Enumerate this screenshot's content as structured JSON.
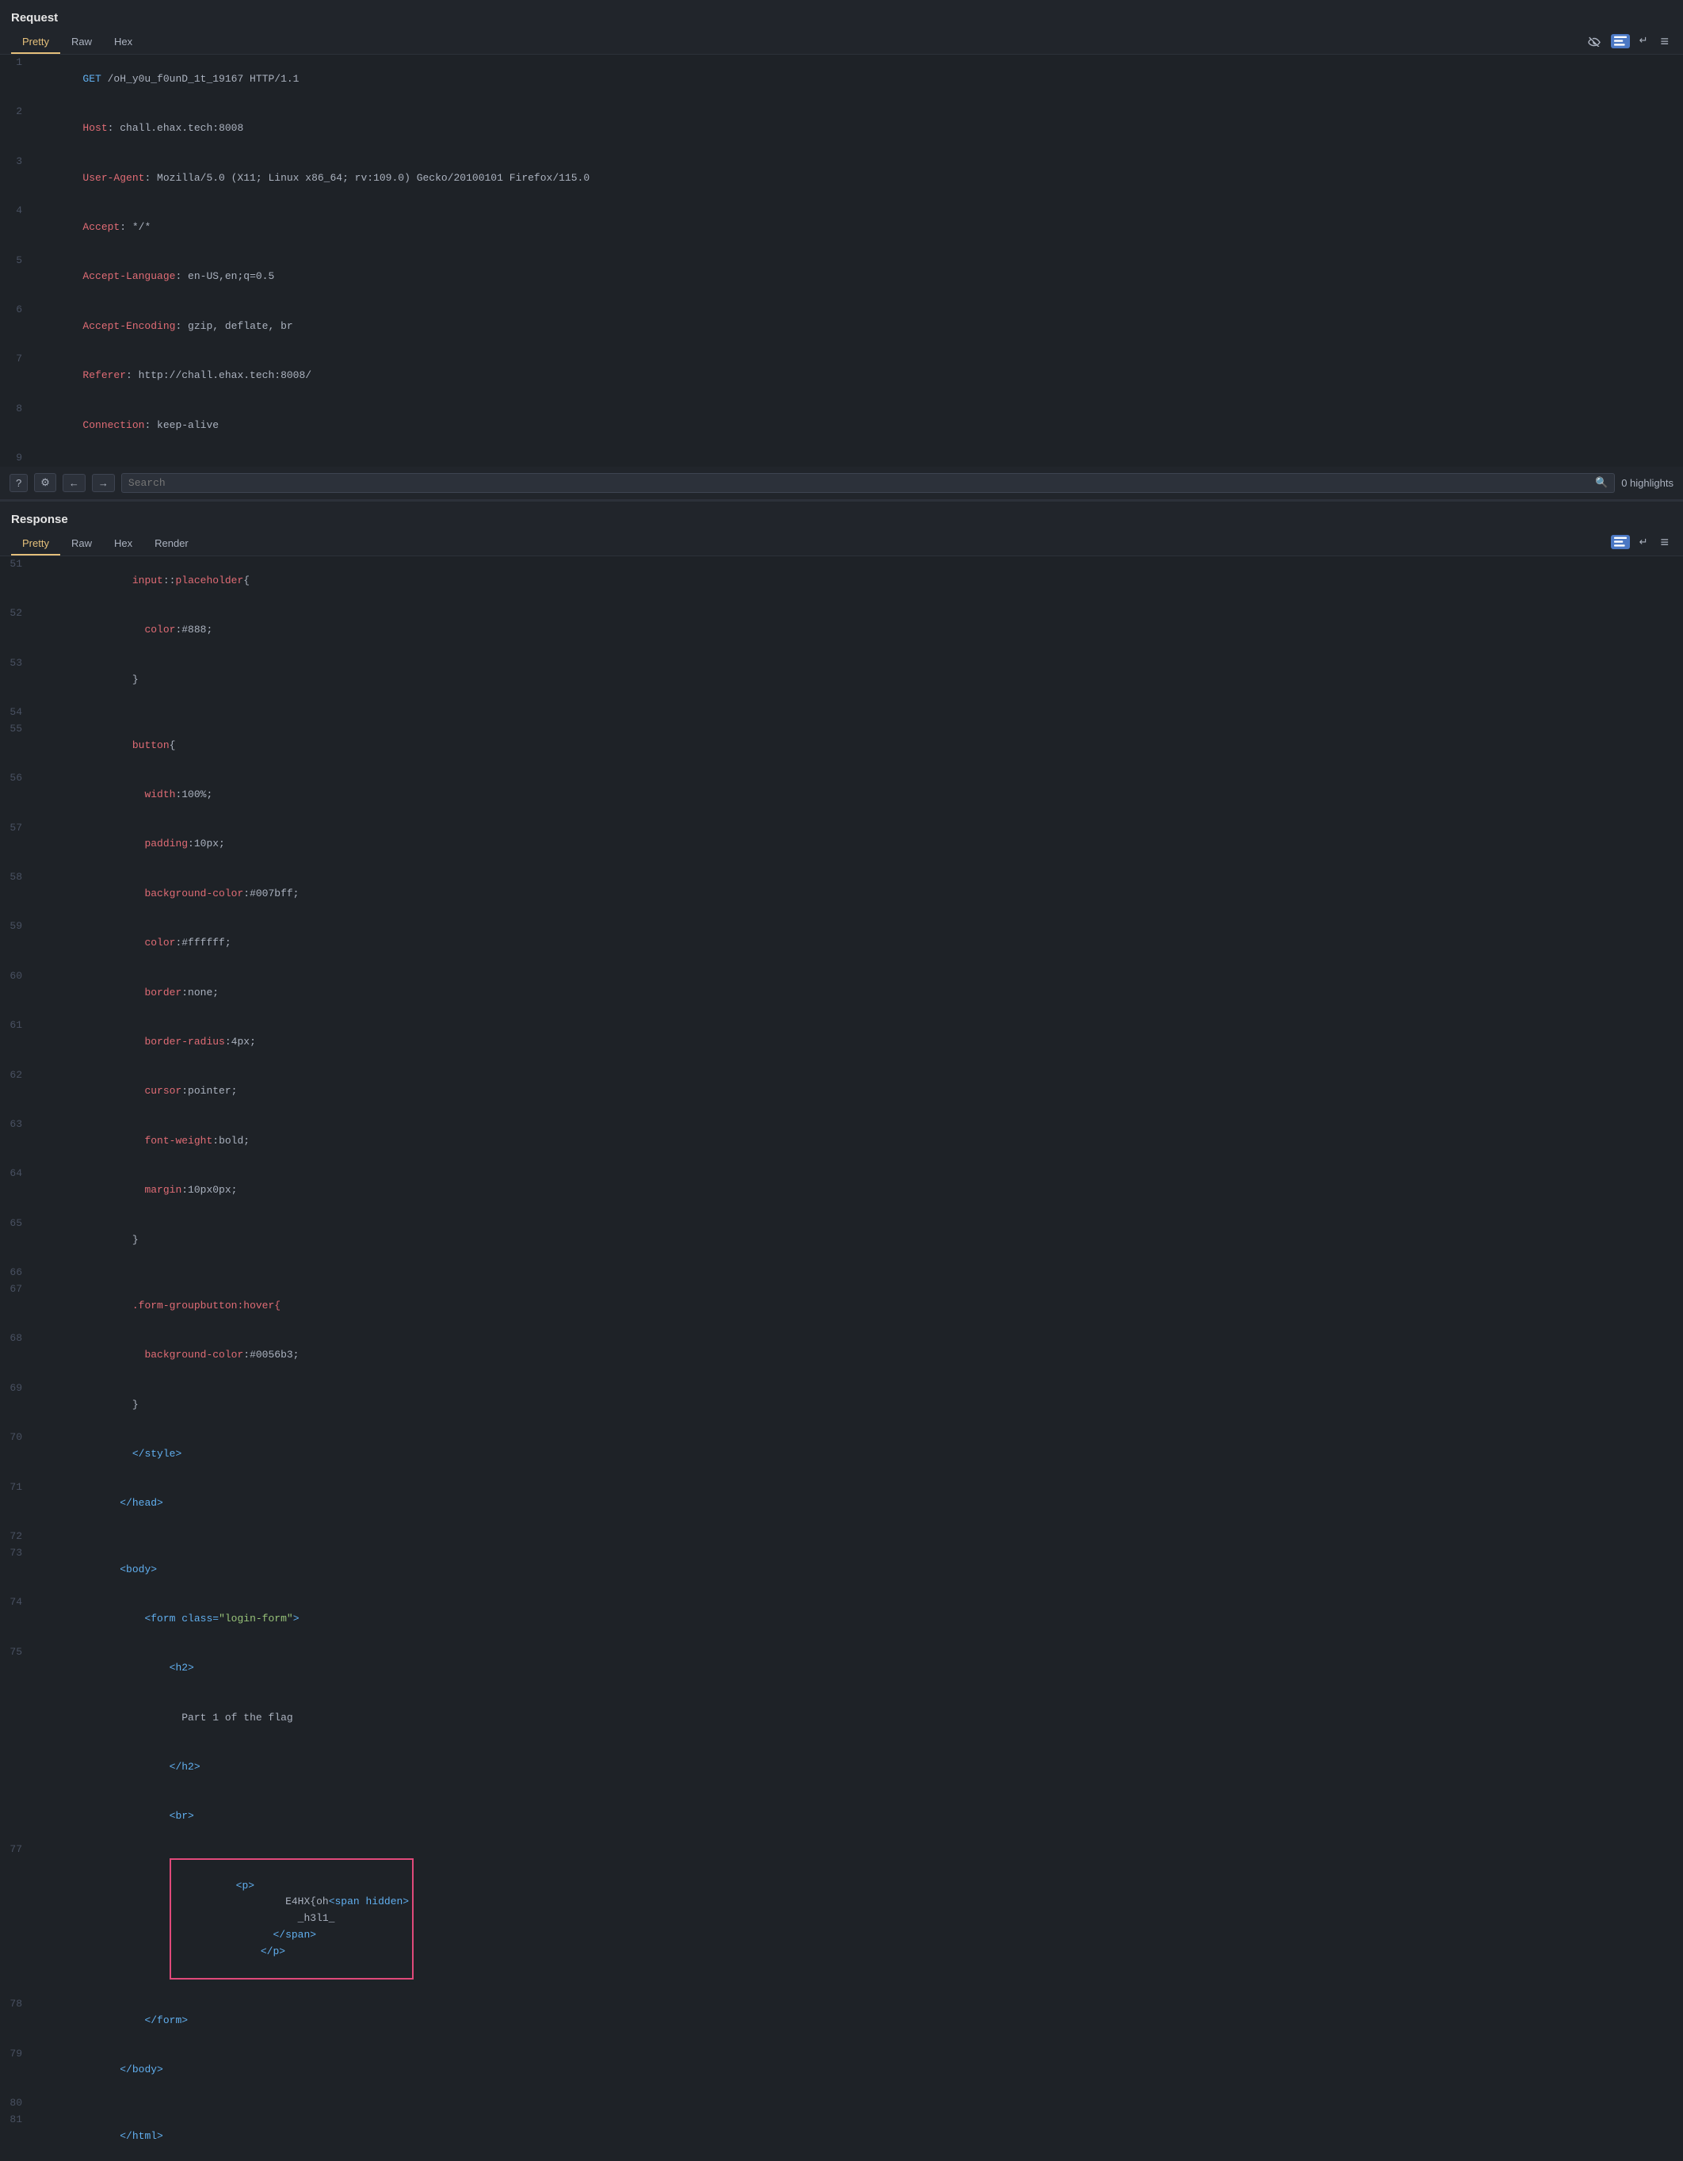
{
  "request": {
    "title": "Request",
    "tabs": [
      {
        "label": "Pretty",
        "active": true
      },
      {
        "label": "Raw",
        "active": false
      },
      {
        "label": "Hex",
        "active": false
      }
    ],
    "lines": [
      {
        "num": "1",
        "content": "GET /oH_y0u_f0unD_1t_19167 HTTP/1.1"
      },
      {
        "num": "2",
        "content": "Host: chall.ehax.tech:8008"
      },
      {
        "num": "3",
        "content": "User-Agent: Mozilla/5.0 (X11; Linux x86_64; rv:109.0) Gecko/20100101 Firefox/115.0"
      },
      {
        "num": "4",
        "content": "Accept: */*"
      },
      {
        "num": "5",
        "content": "Accept-Language: en-US,en;q=0.5"
      },
      {
        "num": "6",
        "content": "Accept-Encoding: gzip, deflate, br"
      },
      {
        "num": "7",
        "content": "Referer: http://chall.ehax.tech:8008/"
      },
      {
        "num": "8",
        "content": "Connection: keep-alive"
      },
      {
        "num": "9",
        "content": ""
      }
    ],
    "search": {
      "placeholder": "Search",
      "value": ""
    },
    "highlights": "0 highlights"
  },
  "response": {
    "title": "Response",
    "tabs": [
      {
        "label": "Pretty",
        "active": true
      },
      {
        "label": "Raw",
        "active": false
      },
      {
        "label": "Hex",
        "active": false
      },
      {
        "label": "Render",
        "active": false
      }
    ],
    "lines": [
      {
        "num": "51",
        "indent": "        ",
        "parts": [
          {
            "text": "input",
            "class": "c-red"
          },
          {
            "text": "::placeholder{",
            "class": "c-white"
          }
        ]
      },
      {
        "num": "52",
        "indent": "          ",
        "parts": [
          {
            "text": "color",
            "class": "c-red"
          },
          {
            "text": ":#888;",
            "class": "c-white"
          }
        ]
      },
      {
        "num": "53",
        "indent": "        ",
        "parts": [
          {
            "text": "}",
            "class": "c-white"
          }
        ]
      },
      {
        "num": "54",
        "indent": "",
        "parts": [
          {
            "text": "",
            "class": "c-white"
          }
        ]
      },
      {
        "num": "55",
        "indent": "        ",
        "parts": [
          {
            "text": "button",
            "class": "c-red"
          },
          {
            "text": "{",
            "class": "c-white"
          }
        ]
      },
      {
        "num": "56",
        "indent": "          ",
        "parts": [
          {
            "text": "width",
            "class": "c-red"
          },
          {
            "text": ":100%;",
            "class": "c-white"
          }
        ]
      },
      {
        "num": "57",
        "indent": "          ",
        "parts": [
          {
            "text": "padding",
            "class": "c-red"
          },
          {
            "text": ":10px;",
            "class": "c-white"
          }
        ]
      },
      {
        "num": "58",
        "indent": "          ",
        "parts": [
          {
            "text": "background-color",
            "class": "c-red"
          },
          {
            "text": ":#007bff;",
            "class": "c-white"
          }
        ]
      },
      {
        "num": "59",
        "indent": "          ",
        "parts": [
          {
            "text": "color",
            "class": "c-red"
          },
          {
            "text": ":#ffffff;",
            "class": "c-white"
          }
        ]
      },
      {
        "num": "60",
        "indent": "          ",
        "parts": [
          {
            "text": "border",
            "class": "c-red"
          },
          {
            "text": ":none;",
            "class": "c-white"
          }
        ]
      },
      {
        "num": "61",
        "indent": "          ",
        "parts": [
          {
            "text": "border-radius",
            "class": "c-red"
          },
          {
            "text": ":4px;",
            "class": "c-white"
          }
        ]
      },
      {
        "num": "62",
        "indent": "          ",
        "parts": [
          {
            "text": "cursor",
            "class": "c-red"
          },
          {
            "text": ":pointer;",
            "class": "c-white"
          }
        ]
      },
      {
        "num": "63",
        "indent": "          ",
        "parts": [
          {
            "text": "font-weight",
            "class": "c-red"
          },
          {
            "text": ":bold;",
            "class": "c-white"
          }
        ]
      },
      {
        "num": "64",
        "indent": "          ",
        "parts": [
          {
            "text": "margin",
            "class": "c-red"
          },
          {
            "text": ":10px0px;",
            "class": "c-white"
          }
        ]
      },
      {
        "num": "65",
        "indent": "        ",
        "parts": [
          {
            "text": "}",
            "class": "c-white"
          }
        ]
      },
      {
        "num": "66",
        "indent": "",
        "parts": [
          {
            "text": "",
            "class": "c-white"
          }
        ]
      },
      {
        "num": "67",
        "indent": "        ",
        "parts": [
          {
            "text": ".form-groupbutton:hover{",
            "class": "c-red"
          }
        ]
      },
      {
        "num": "68",
        "indent": "          ",
        "parts": [
          {
            "text": "background-color",
            "class": "c-red"
          },
          {
            "text": ":#0056b3;",
            "class": "c-white"
          }
        ]
      },
      {
        "num": "69",
        "indent": "        ",
        "parts": [
          {
            "text": "}",
            "class": "c-white"
          }
        ]
      },
      {
        "num": "70",
        "indent": "        ",
        "parts": [
          {
            "text": "</style>",
            "class": "c-blue"
          }
        ]
      },
      {
        "num": "71",
        "indent": "      ",
        "parts": [
          {
            "text": "</head>",
            "class": "c-blue"
          }
        ]
      },
      {
        "num": "72",
        "indent": "",
        "parts": [
          {
            "text": "",
            "class": "c-white"
          }
        ]
      },
      {
        "num": "73",
        "indent": "      ",
        "parts": [
          {
            "text": "<body>",
            "class": "c-blue"
          }
        ]
      },
      {
        "num": "74",
        "indent": "          ",
        "parts": [
          {
            "text": "<form class=",
            "class": "c-blue"
          },
          {
            "text": "\"login-form\"",
            "class": "c-green"
          },
          {
            "text": ">",
            "class": "c-blue"
          }
        ]
      },
      {
        "num": "75",
        "indent": "              ",
        "parts": [
          {
            "text": "<h2>",
            "class": "c-blue"
          },
          {
            "text": "\n                Part 1 of the flag\n              ",
            "class": "c-white"
          },
          {
            "text": "</h2>",
            "class": "c-blue"
          }
        ]
      },
      {
        "num": "",
        "indent": "              ",
        "parts": [
          {
            "text": "<br>",
            "class": "c-blue"
          }
        ]
      },
      {
        "num": "77",
        "indent": "              ",
        "parts": [
          {
            "text": "<p>",
            "class": "c-blue"
          },
          {
            "text": "\n                  E4HX{oh",
            "class": "c-white"
          },
          {
            "text": "<span hidden>",
            "class": "c-blue"
          },
          {
            "text": "\n                    _h3l1_\n                  ",
            "class": "c-white"
          },
          {
            "text": "</span>",
            "class": "c-blue"
          },
          {
            "text": "\n              ",
            "class": "c-white"
          },
          {
            "text": "</p>",
            "class": "c-blue"
          }
        ]
      },
      {
        "num": "78",
        "indent": "          ",
        "parts": [
          {
            "text": "</form>",
            "class": "c-blue"
          }
        ]
      },
      {
        "num": "79",
        "indent": "      ",
        "parts": [
          {
            "text": "</body>",
            "class": "c-blue"
          }
        ]
      },
      {
        "num": "80",
        "indent": "",
        "parts": [
          {
            "text": "",
            "class": "c-white"
          }
        ]
      },
      {
        "num": "81",
        "indent": "      ",
        "parts": [
          {
            "text": "</html>",
            "class": "c-blue"
          }
        ]
      }
    ]
  },
  "icons": {
    "eye_slash": "⊘",
    "list": "≡",
    "newline": "↵",
    "search": "🔍",
    "back": "←",
    "forward": "→",
    "help": "?",
    "settings": "⚙"
  }
}
